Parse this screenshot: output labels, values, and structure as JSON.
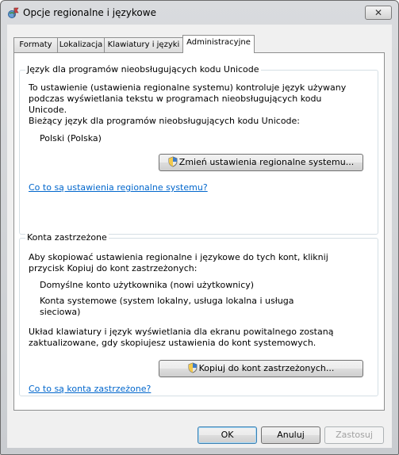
{
  "window": {
    "title": "Opcje regionalne i językowe"
  },
  "tabs": [
    {
      "label": "Formaty"
    },
    {
      "label": "Lokalizacja"
    },
    {
      "label": "Klawiatury i języki"
    },
    {
      "label": "Administracyjne"
    }
  ],
  "unicode_group": {
    "legend": "Język dla programów nieobsługujących kodu Unicode",
    "desc_line1": "To ustawienie (ustawienia regionalne systemu) kontroluje język używany",
    "desc_line2": "podczas wyświetlania tekstu w programach nieobsługujących kodu",
    "desc_line3": "Unicode.",
    "current_label": "Bieżący język dla programów nieobsługujących kodu Unicode:",
    "current_value": "Polski (Polska)",
    "change_button": "Zmień ustawienia regionalne systemu...",
    "help_link": "Co to są ustawienia regionalne systemu?"
  },
  "reserved_group": {
    "legend": "Konta zastrzeżone",
    "desc_line1": "Aby skopiować ustawienia regionalne i językowe do tych kont, kliknij",
    "desc_line2": "przycisk Kopiuj do kont zastrzeżonych:",
    "item1": "Domyślne konto użytkownika (nowi użytkownicy)",
    "item2_line1": "Konta systemowe (system lokalny, usługa lokalna i usługa",
    "item2_line2": "sieciowa)",
    "note_line1": "Układ klawiatury i język wyświetlania dla ekranu powitalnego zostaną",
    "note_line2": "zaktualizowane, gdy skopiujesz ustawienia do kont systemowych.",
    "copy_button": "Kopiuj do kont zastrzeżonych...",
    "help_link": "Co to są konta zastrzeżone?"
  },
  "buttons": {
    "ok": "OK",
    "cancel": "Anuluj",
    "apply": "Zastosuj"
  },
  "close_glyph": "✕"
}
